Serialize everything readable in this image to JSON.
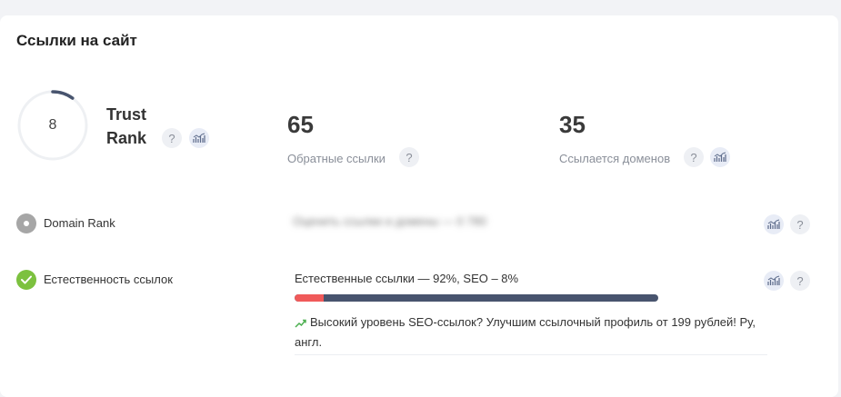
{
  "section": {
    "title": "Ссылки на сайт"
  },
  "trust_rank": {
    "value": "8",
    "label": "Trust Rank",
    "progress": 0.1
  },
  "backlinks": {
    "value": "65",
    "label": "Обратные ссылки"
  },
  "domains": {
    "value": "35",
    "label": "Ссылается доменов"
  },
  "domain_rank": {
    "label": "Domain Rank",
    "blurred_text": "Оценить ссылки и домены — 0 780"
  },
  "naturalness": {
    "label": "Естественность ссылок",
    "summary": "Естественные ссылки — 92%, SEO – 8%",
    "natural_percent": 92,
    "seo_percent": 8,
    "note": "Высокий уровень SEO-ссылок? Улучшим ссылочный профиль от 199 рублей! Ру, англ."
  },
  "icons": {
    "help": "?",
    "chart": "chart-icon",
    "check": "check-icon"
  },
  "colors": {
    "accent_dark": "#48546e",
    "seo_red": "#f05a5a",
    "success_green": "#7cc13f",
    "neutral_grey": "#a6a6a6",
    "trend_green": "#4caf50"
  }
}
